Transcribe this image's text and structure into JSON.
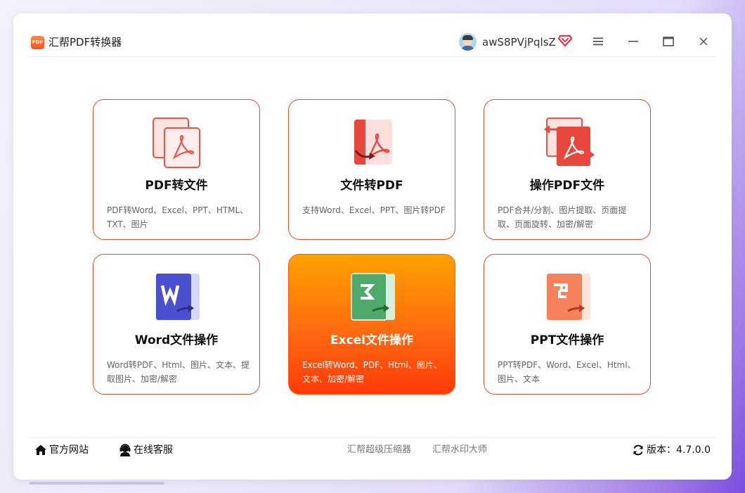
{
  "app": {
    "title": "汇帮PDF转换器",
    "logo_text": "PDF"
  },
  "user": {
    "name": "awS8PVjPqlsZ"
  },
  "colors": {
    "accent": "#e04a2f",
    "card_border": "#d8553a",
    "active_gradient_top": "#ffa200",
    "active_gradient_bottom": "#ff3a0a"
  },
  "cards": [
    {
      "title": "PDF转文件",
      "desc": "PDF转Word、Excel、PPT、HTML、TXT、图片",
      "icon": "pdf-to-file-icon"
    },
    {
      "title": "文件转PDF",
      "desc": "支持Word、Excel、PPT、图片转PDF",
      "icon": "file-to-pdf-icon"
    },
    {
      "title": "操作PDF文件",
      "desc": "PDF合并/分割、图片提取、页面提取、页面旋转、加密/解密",
      "icon": "operate-pdf-icon"
    },
    {
      "title": "Word文件操作",
      "desc": "Word转PDF、Html、图片、文本、提取图片、加密/解密",
      "icon": "word-icon"
    },
    {
      "title": "Excel文件操作",
      "desc": "Excel转Word、PDF、Html、图片、文本、加密/解密",
      "icon": "excel-icon",
      "active": true
    },
    {
      "title": "PPT文件操作",
      "desc": "PPT转PDF、Word、Excel、Html、图片、文本",
      "icon": "ppt-icon"
    }
  ],
  "footer": {
    "website": "官方网站",
    "service": "在线客服",
    "compressor": "汇帮超级压缩器",
    "watermark": "汇帮水印大师",
    "version_label": "版本：",
    "version": "4.7.0.0"
  }
}
